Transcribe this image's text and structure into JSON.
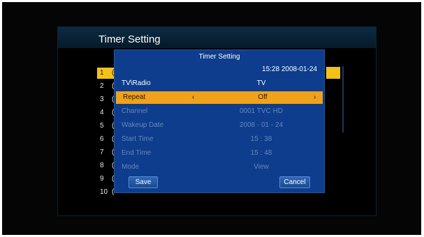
{
  "screen": {
    "title": "Timer Setting"
  },
  "timer_list": [
    {
      "num": "1",
      "edge": "("
    },
    {
      "num": "2",
      "edge": "("
    },
    {
      "num": "3",
      "edge": "("
    },
    {
      "num": "4",
      "edge": "("
    },
    {
      "num": "5",
      "edge": "("
    },
    {
      "num": "6",
      "edge": "("
    },
    {
      "num": "7",
      "edge": "("
    },
    {
      "num": "8",
      "edge": "("
    },
    {
      "num": "9",
      "edge": "("
    },
    {
      "num": "10",
      "edge": "("
    }
  ],
  "dialog": {
    "title": "Timer Setting",
    "datetime": "15:28 2008-01-24",
    "rows": [
      {
        "label": "TV\\Radio",
        "value": "TV"
      },
      {
        "label": "Repeat",
        "value": "Off",
        "left_arrow": "‹",
        "right_arrow": "›"
      },
      {
        "label": "Channel",
        "value": "0001 TVC HD"
      },
      {
        "label": "Wakeup Date",
        "value": "2008 - 01 - 24"
      },
      {
        "label": "Start Time",
        "value": "15 : 38"
      },
      {
        "label": "End Time",
        "value": "15 : 48"
      },
      {
        "label": "Mode",
        "value": "View"
      }
    ],
    "save_label": "Save",
    "cancel_label": "Cancel"
  },
  "colors": {
    "highlight": "#f0a21b",
    "selection": "#f2c21a",
    "dialog_bg": "#0d3d8c"
  }
}
